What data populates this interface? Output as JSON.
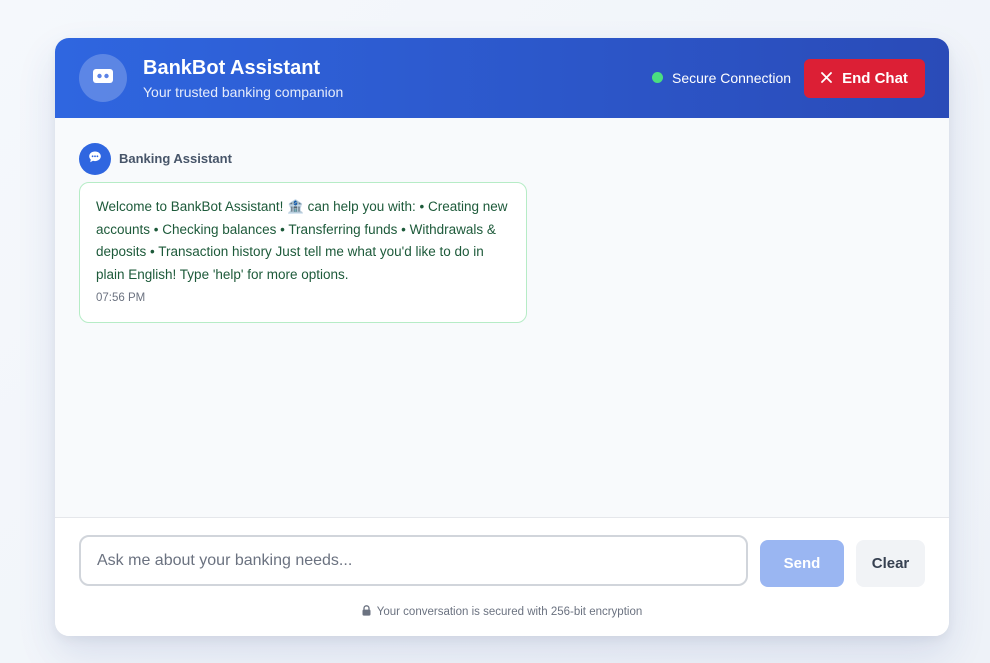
{
  "header": {
    "title": "BankBot Assistant",
    "subtitle": "Your trusted banking companion",
    "status_text": "Secure Connection",
    "end_chat_label": "End Chat"
  },
  "conversation": {
    "messages": [
      {
        "sender": "Banking Assistant",
        "text": "Welcome to BankBot Assistant! 🏦 can help you with: • Creating new accounts • Checking balances • Transferring funds • Withdrawals & deposits • Transaction history Just tell me what you'd like to do in plain English! Type 'help' for more options.",
        "time": "07:56 PM"
      }
    ]
  },
  "composer": {
    "placeholder": "Ask me about your banking needs...",
    "value": "",
    "send_label": "Send",
    "clear_label": "Clear"
  },
  "footer": {
    "security_note": "Your conversation is secured with 256-bit encryption"
  },
  "colors": {
    "header_start": "#2f66e0",
    "header_end": "#2a4bb8",
    "status_online": "#4ade80",
    "end_chat": "#dc1f35",
    "send_disabled": "#9ab6f2",
    "bubble_border": "#b6ecc6",
    "bubble_text": "#1d5a3a"
  },
  "icons": {
    "bot_avatar": "robot-icon",
    "sender_avatar": "chat-bubble-icon",
    "end_chat": "close-icon",
    "security": "lock-icon"
  }
}
